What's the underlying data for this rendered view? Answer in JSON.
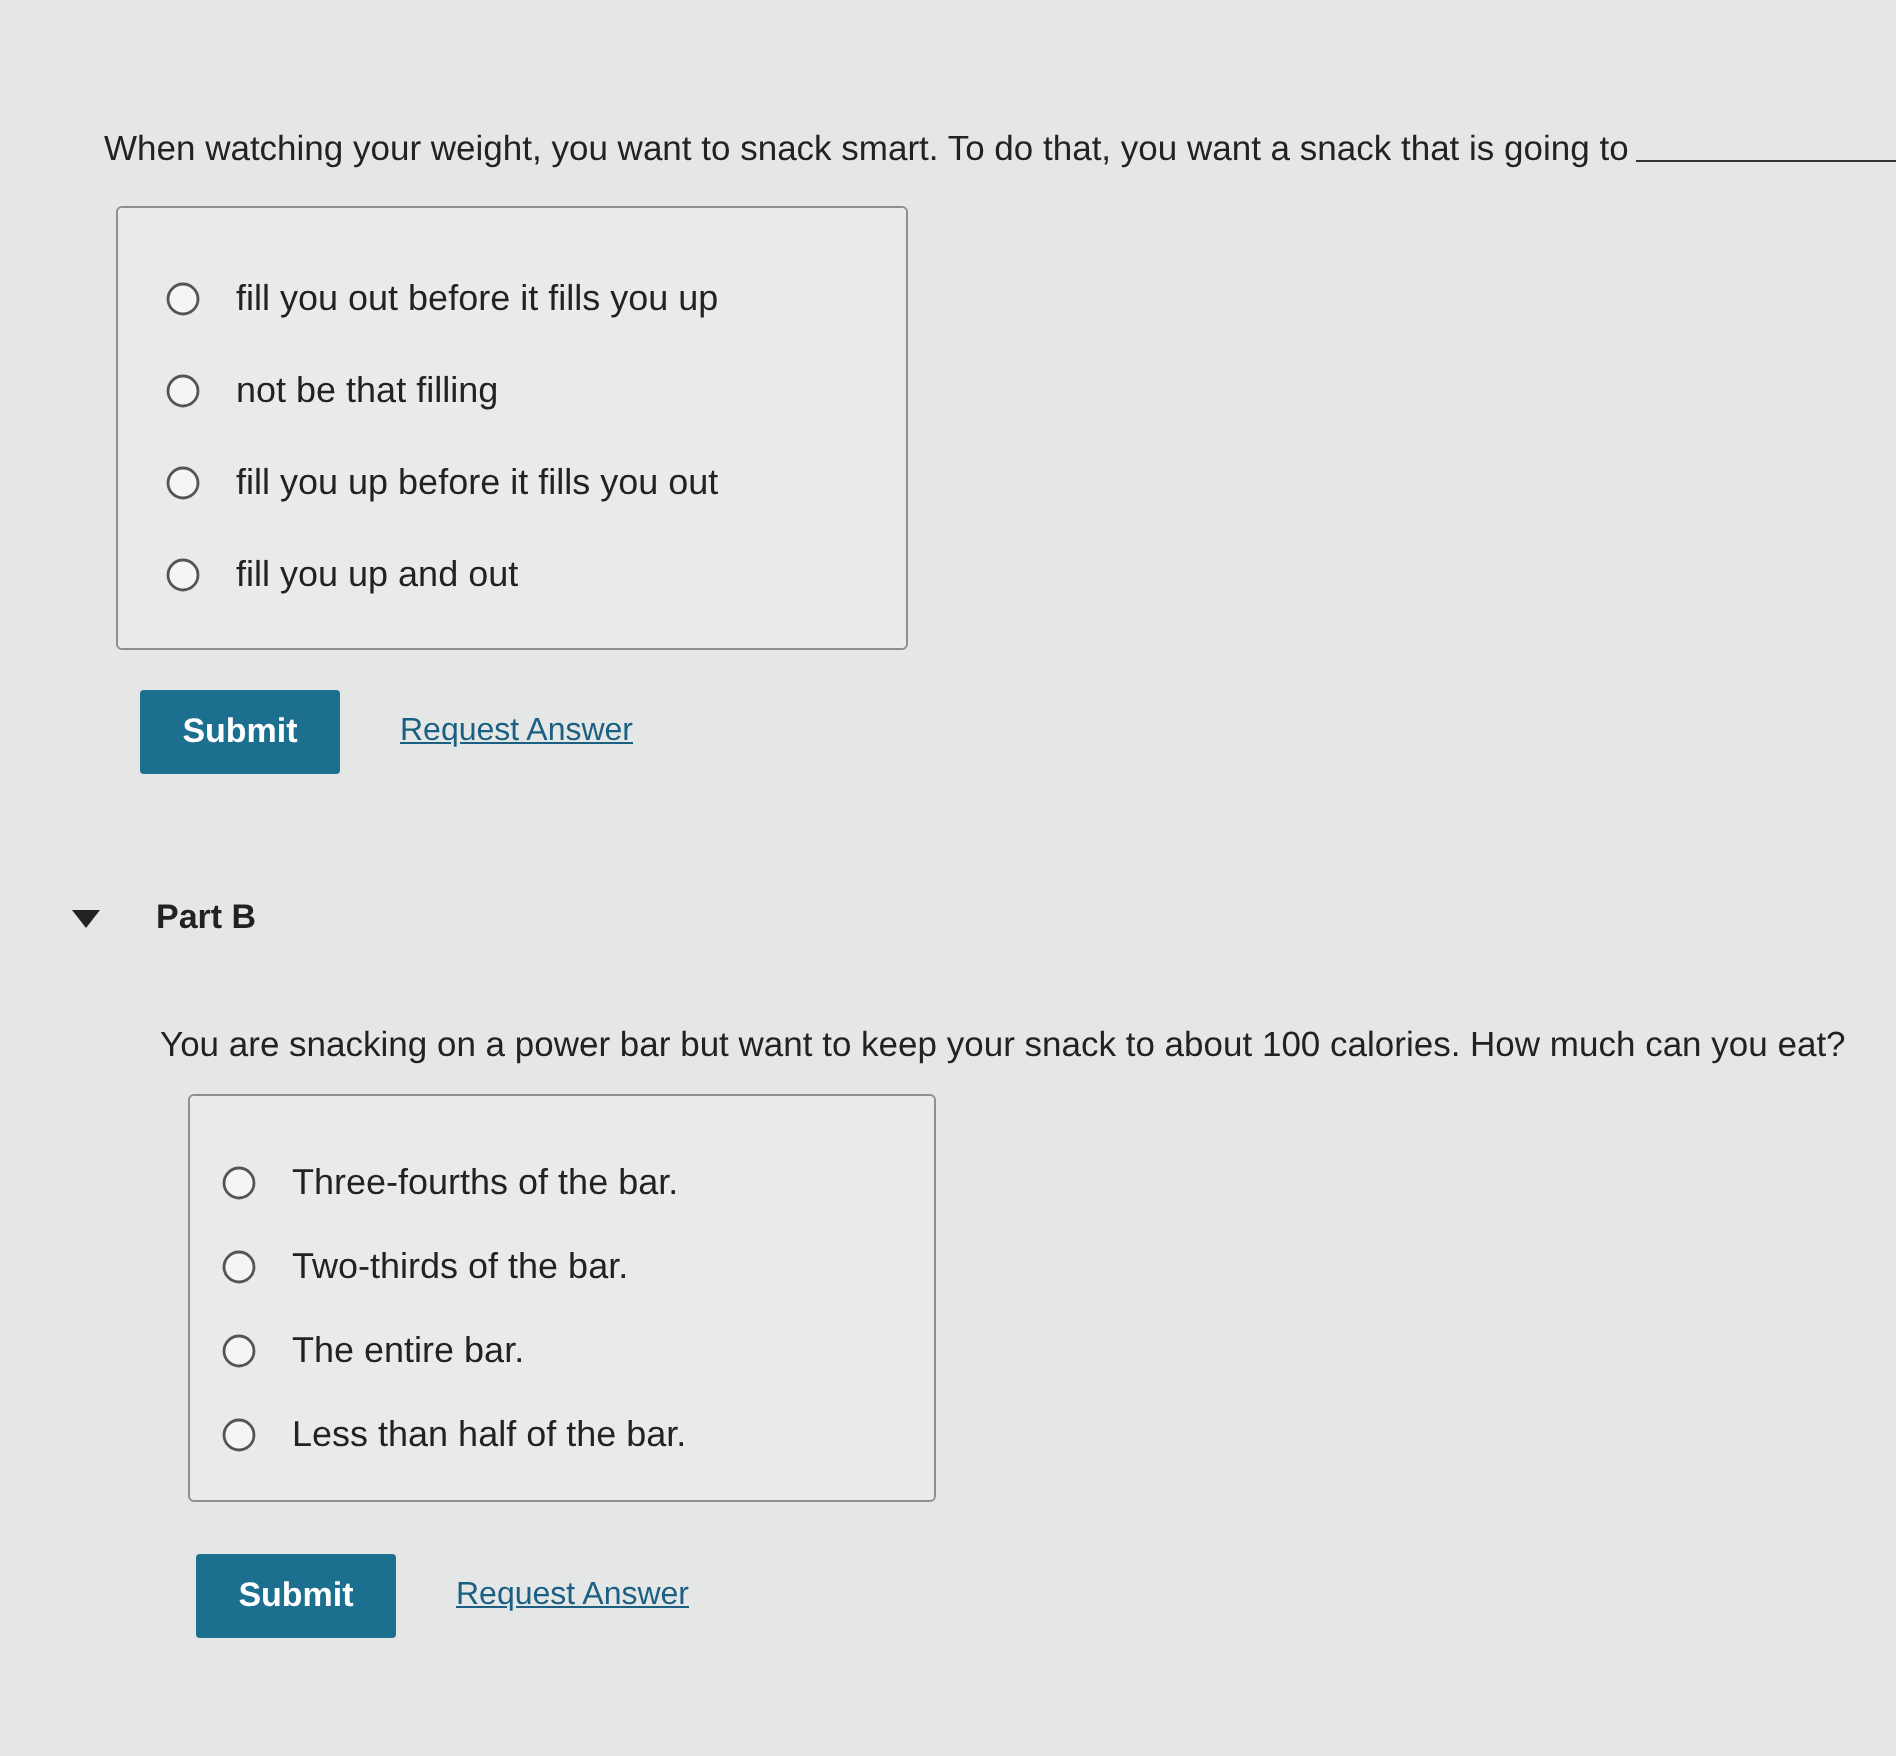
{
  "parts": [
    {
      "question": "When watching your weight, you want to snack smart. To do that, you want a snack that is going to",
      "has_blank": true,
      "options": [
        {
          "label": "fill you out before it fills you up",
          "selected": false
        },
        {
          "label": "not be that filling",
          "selected": false
        },
        {
          "label": "fill you up before it fills you out",
          "selected": false
        },
        {
          "label": "fill you up and out",
          "selected": false
        }
      ],
      "submit": "Submit",
      "request_answer": "Request Answer"
    },
    {
      "title": "Part B",
      "expanded": true,
      "question": "You are snacking on a power bar but want to keep your snack to about 100 calories. How much can you eat?",
      "options": [
        {
          "label": "Three-fourths of the bar.",
          "selected": false
        },
        {
          "label": "Two-thirds of the bar.",
          "selected": false
        },
        {
          "label": "The entire bar.",
          "selected": false
        },
        {
          "label": "Less than half of the bar.",
          "selected": false
        }
      ],
      "submit": "Submit",
      "request_answer": "Request Answer"
    }
  ]
}
